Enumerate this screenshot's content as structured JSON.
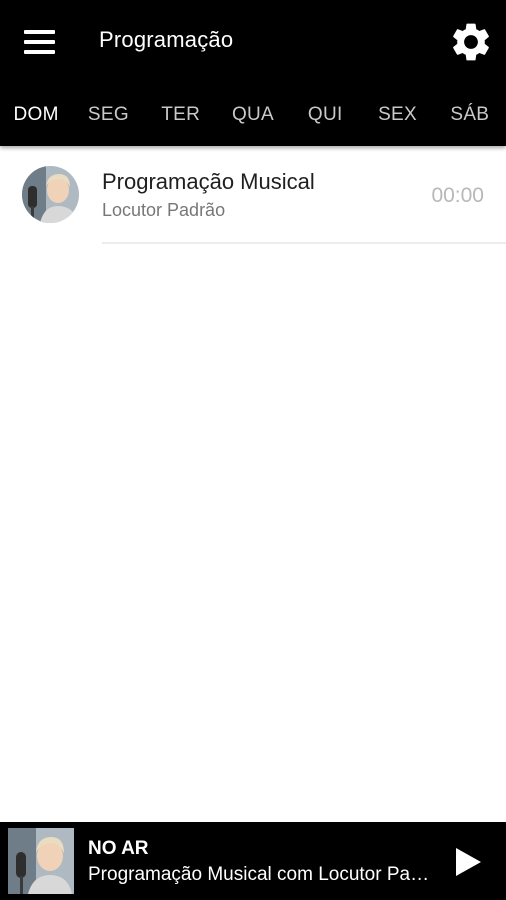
{
  "header": {
    "title": "Programação",
    "menu_icon": "menu-icon",
    "settings_icon": "gear-icon"
  },
  "tabs": [
    {
      "label": "DOM",
      "active": true
    },
    {
      "label": "SEG",
      "active": false
    },
    {
      "label": "TER",
      "active": false
    },
    {
      "label": "QUA",
      "active": false
    },
    {
      "label": "QUI",
      "active": false
    },
    {
      "label": "SEX",
      "active": false
    },
    {
      "label": "SÁB",
      "active": false
    }
  ],
  "schedule": [
    {
      "program": "Programação Musical",
      "host": "Locutor Padrão",
      "time": "00:00"
    }
  ],
  "player": {
    "status": "NO AR",
    "now_playing": "Programação Musical com Locutor Padrão",
    "play_icon": "play-icon"
  },
  "colors": {
    "bar_background": "#000000",
    "tab_active": "#ffffff",
    "tab_inactive": "#c9c9c9",
    "time_text": "#b8b8b8"
  }
}
